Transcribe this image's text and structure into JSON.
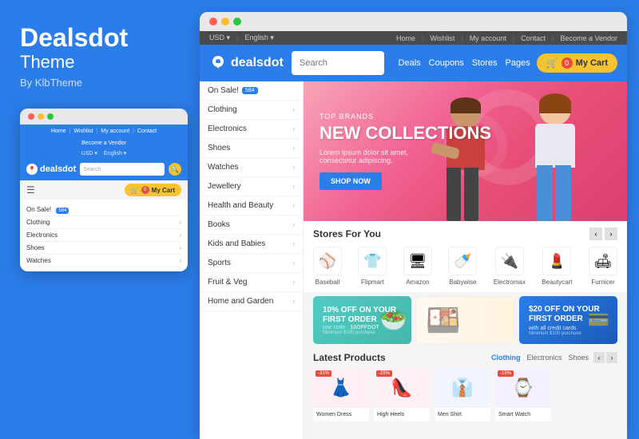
{
  "brand": {
    "name": "Dealsdot",
    "subtitle": "Theme",
    "by": "By KlbTheme"
  },
  "mini_browser": {
    "nav_links": [
      "Home",
      "|",
      "Wishlist",
      "|",
      "My account",
      "|",
      "Contact"
    ],
    "become_vendor": "Become a Vendor",
    "currency": "USD ▾",
    "language": "English ▾",
    "logo": "dealsdot",
    "search_placeholder": "Search",
    "cart_label": "My Cart",
    "cart_count": "0",
    "menu_items": [
      {
        "label": "On Sale!",
        "badge": "584",
        "has_badge": true
      },
      {
        "label": "Clothing"
      },
      {
        "label": "Electronics"
      },
      {
        "label": "Shoes"
      },
      {
        "label": "Watches"
      }
    ]
  },
  "top_util": {
    "home": "Home",
    "wishlist": "Wishlist",
    "my_account": "My account",
    "contact": "Contact",
    "become_vendor": "Become a Vendor",
    "currency": "USD ▾",
    "language": "English ▾"
  },
  "header": {
    "logo_text": "dealsdot",
    "search_placeholder": "Search",
    "nav": [
      "Deals",
      "Coupons",
      "Stores",
      "Pages"
    ],
    "cart_label": "My Cart",
    "cart_count": "0"
  },
  "sidebar": {
    "items": [
      {
        "label": "On Sale!",
        "badge": "584",
        "has_arrow": false
      },
      {
        "label": "Clothing",
        "has_arrow": true
      },
      {
        "label": "Electronics",
        "has_arrow": true
      },
      {
        "label": "Shoes",
        "has_arrow": true
      },
      {
        "label": "Watches",
        "has_arrow": true
      },
      {
        "label": "Jewellery",
        "has_arrow": true
      },
      {
        "label": "Health and Beauty",
        "has_arrow": true
      },
      {
        "label": "Books",
        "has_arrow": true
      },
      {
        "label": "Kids and Babies",
        "has_arrow": true
      },
      {
        "label": "Sports",
        "has_arrow": true
      },
      {
        "label": "Fruit & Veg",
        "has_arrow": true
      },
      {
        "label": "Home and Garden",
        "has_arrow": true
      }
    ]
  },
  "hero": {
    "top_label": "TOP BRANDS",
    "title": "NEW COLLECTIONS",
    "desc": "Lorem ipsum dolor sit amet, consectetur adipiscing.",
    "btn": "SHOP NOW"
  },
  "stores": {
    "title": "Stores For You",
    "items": [
      {
        "icon": "⚾",
        "label": "Baseball"
      },
      {
        "icon": "👕",
        "label": "Flipmart"
      },
      {
        "icon": "🖥",
        "label": "Amazon"
      },
      {
        "icon": "🍼",
        "label": "Babywise"
      },
      {
        "icon": "🔌",
        "label": "Electromax"
      },
      {
        "icon": "💄",
        "label": "Beautycart"
      },
      {
        "icon": "🪑",
        "label": "Furnicer"
      }
    ]
  },
  "promos": [
    {
      "title": "10% OFF ON YOUR FIRST ORDER",
      "code_label": "use code : ",
      "code": "10OFFDOT",
      "min": "Minimum $100 purchase",
      "type": "teal"
    },
    {
      "type": "food_img"
    },
    {
      "title": "$20 OFF ON YOUR FIRST ORDER",
      "sub": "with all credit cards",
      "min": "Minimum $100 purchase",
      "type": "blue"
    }
  ],
  "latest": {
    "title": "Latest Products",
    "tabs": [
      "Clothing",
      "Electronics",
      "Shoes"
    ],
    "nav_prev": "‹",
    "nav_next": "›",
    "products": [
      {
        "icon": "👗",
        "discount": "-31%"
      },
      {
        "icon": "👠",
        "discount": "-25%"
      },
      {
        "icon": "👔",
        "discount": ""
      },
      {
        "icon": "⌚",
        "discount": "-15%"
      }
    ]
  },
  "icons": {
    "search": "🔍",
    "cart": "🛒",
    "chevron_right": "›",
    "chevron_left": "‹"
  }
}
